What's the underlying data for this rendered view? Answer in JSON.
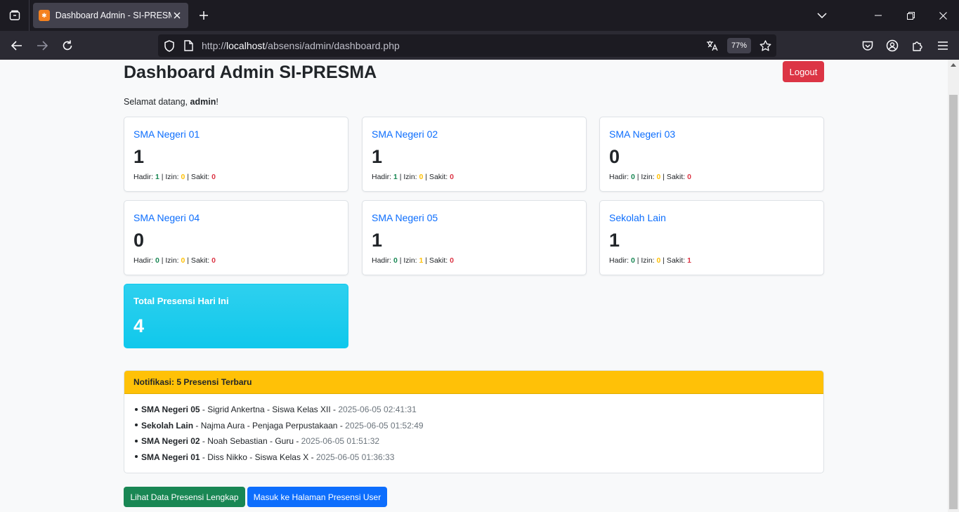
{
  "browser": {
    "tab_title": "Dashboard Admin - SI-PRESMA",
    "url_prefix": "http://",
    "url_host": "localhost",
    "url_path": "/absensi/admin/dashboard.php",
    "zoom": "77%"
  },
  "page": {
    "title": "Dashboard Admin SI-PRESMA",
    "logout_label": "Logout",
    "welcome_prefix": "Selamat datang, ",
    "welcome_user": "admin",
    "welcome_suffix": "!"
  },
  "labels": {
    "hadir": "Hadir: ",
    "izin": " | Izin: ",
    "sakit": " | Sakit: "
  },
  "schools": [
    {
      "name": "SMA Negeri 01",
      "count": "1",
      "hadir": "1",
      "izin": "0",
      "sakit": "0"
    },
    {
      "name": "SMA Negeri 02",
      "count": "1",
      "hadir": "1",
      "izin": "0",
      "sakit": "0"
    },
    {
      "name": "SMA Negeri 03",
      "count": "0",
      "hadir": "0",
      "izin": "0",
      "sakit": "0"
    },
    {
      "name": "SMA Negeri 04",
      "count": "0",
      "hadir": "0",
      "izin": "0",
      "sakit": "0"
    },
    {
      "name": "SMA Negeri 05",
      "count": "1",
      "hadir": "0",
      "izin": "1",
      "sakit": "0"
    },
    {
      "name": "Sekolah Lain",
      "count": "1",
      "hadir": "0",
      "izin": "0",
      "sakit": "1"
    }
  ],
  "total": {
    "label": "Total Presensi Hari Ini",
    "value": "4"
  },
  "notifications": {
    "header": "Notifikasi: 5 Presensi Terbaru",
    "items": [
      {
        "school": "SMA Negeri 05",
        "detail": " - Sigrid Ankertna - Siswa Kelas XII - ",
        "time": "2025-06-05 02:41:31"
      },
      {
        "school": "Sekolah Lain",
        "detail": " - Najma Aura - Penjaga Perpustakaan - ",
        "time": "2025-06-05 01:52:49"
      },
      {
        "school": "SMA Negeri 02",
        "detail": " - Noah Sebastian - Guru - ",
        "time": "2025-06-05 01:51:32"
      },
      {
        "school": "SMA Negeri 01",
        "detail": " - Diss Nikko - Siswa Kelas X - ",
        "time": "2025-06-05 01:36:33"
      }
    ]
  },
  "actions": {
    "view_all": "Lihat Data Presensi Lengkap",
    "user_page": "Masuk ke Halaman Presensi User"
  },
  "colors": {
    "primary": "#0d6efd",
    "danger": "#dc3545",
    "success": "#198754",
    "warning": "#ffc107",
    "info": "#0dcaf0"
  }
}
